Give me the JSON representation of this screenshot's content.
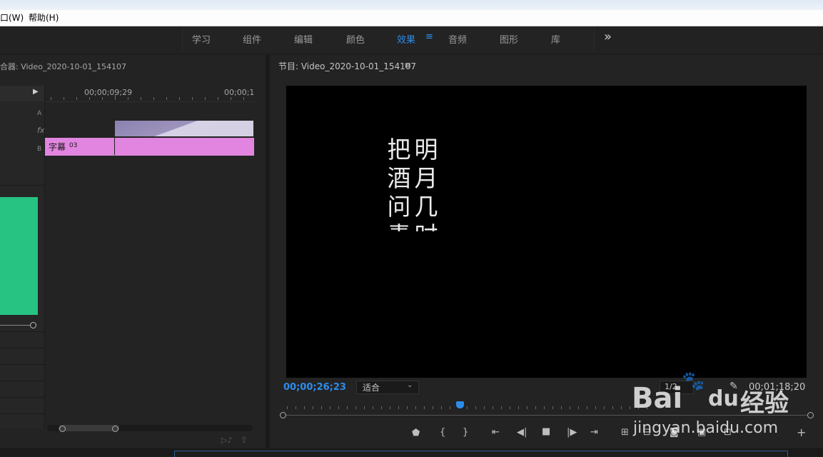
{
  "menu": {
    "window": "口(W)",
    "help": "帮助(H)"
  },
  "workspace": {
    "tabs": [
      {
        "label": "学习"
      },
      {
        "label": "组件"
      },
      {
        "label": "编辑"
      },
      {
        "label": "颜色"
      },
      {
        "label": "效果",
        "active": true
      },
      {
        "label": "音频"
      },
      {
        "label": "图形"
      },
      {
        "label": "库"
      }
    ],
    "menu_glyph": "≡",
    "overflow_glyph": "»"
  },
  "source": {
    "title": "合器: Video_2020-10-01_154107",
    "timecode_1": "00;00;09;29",
    "timecode_2": "00;00;1",
    "track_a": "A",
    "track_fx": "fx",
    "track_b": "B",
    "clip_label": "字幕",
    "clip_num": "03",
    "green_color": "#27c383",
    "clip_color": "#e285e0"
  },
  "program": {
    "title": "节目: Video_2020-10-01_154107",
    "menu_glyph": "≡",
    "poem": {
      "col1": [
        "把",
        "酒",
        "问",
        "青"
      ],
      "col2": [
        "明",
        "月",
        "几",
        "时"
      ]
    },
    "timecode_current": "00;00;26;23",
    "zoom_value": "适合",
    "resolution": "1/2",
    "duration": "00;01;18;20",
    "accent_color": "#2d8ceb"
  },
  "watermark": {
    "brand_left": "Bai",
    "brand_right": "du",
    "brand_cn": "经验",
    "url": "jingyan.baidu.com"
  }
}
